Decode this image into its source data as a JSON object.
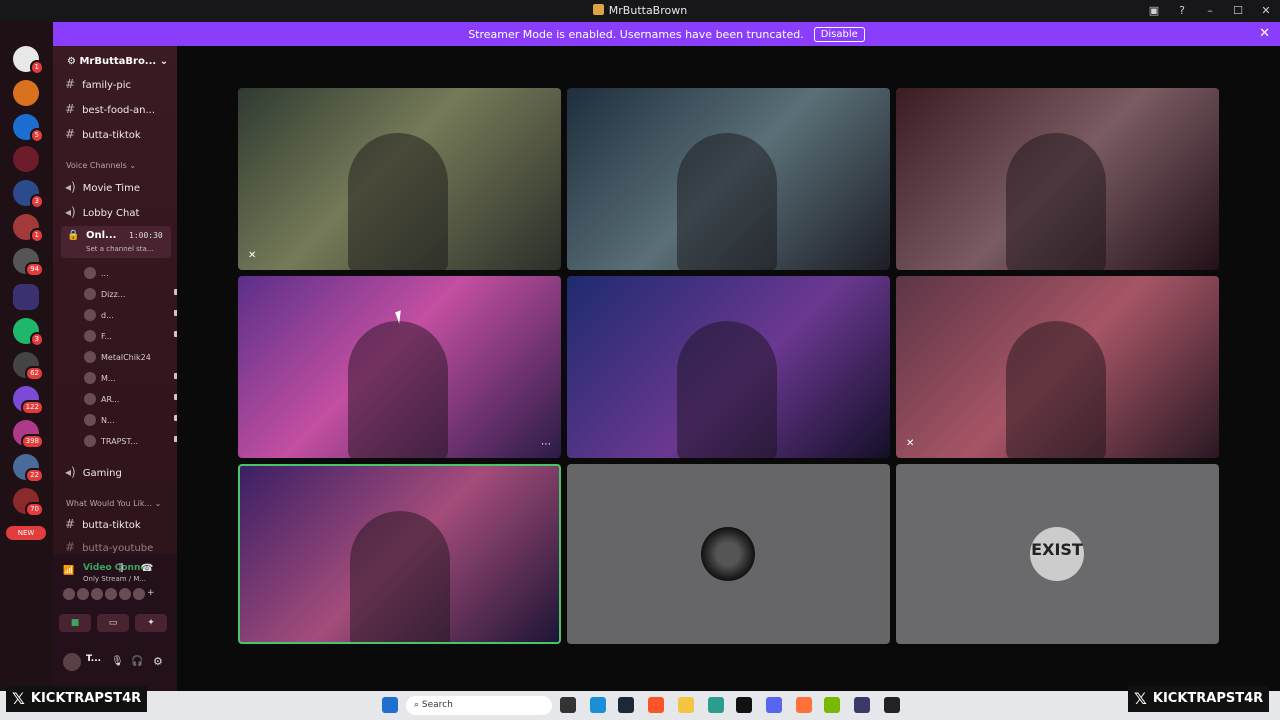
{
  "window": {
    "title": "MrButtaBrown"
  },
  "banner": {
    "text": "Streamer Mode is enabled. Usernames have been truncated.",
    "button": "Disable"
  },
  "server": {
    "name": "MrButtaBro..."
  },
  "channels": {
    "text_top": [
      "family-pic",
      "best-food-an...",
      "butta-tiktok"
    ],
    "voice_category": "Voice Channels",
    "voice": [
      "Movie Time",
      "Lobby Chat"
    ],
    "active": {
      "name": "Onl...",
      "timer": "1:00:30",
      "status": "Set a channel sta..."
    },
    "voice_users": [
      "...",
      "Dizz...",
      "d...",
      "F...",
      "MetalChik24",
      "M...",
      "AR...",
      "N...",
      "TRAPST..."
    ],
    "gaming": "Gaming",
    "category2": "What Would You Lik...",
    "text_bottom": [
      "butta-tiktok",
      "butta-youtube"
    ]
  },
  "voice_panel": {
    "title": "Video Connec",
    "subtitle": "Only Stream / M...",
    "user": "T..."
  },
  "servers": {
    "badges": [
      "1",
      "5",
      "3",
      "1",
      "94",
      "3",
      "62",
      "122",
      "398",
      "22",
      "70"
    ],
    "new_label": "NEW"
  },
  "tiles": {
    "tile8_label": "",
    "tile9_label": "EXIST"
  },
  "taskbar": {
    "search": "Search"
  },
  "overlay": {
    "left": "KICKTRAPST4R",
    "right": "KICKTRAPST4R"
  }
}
